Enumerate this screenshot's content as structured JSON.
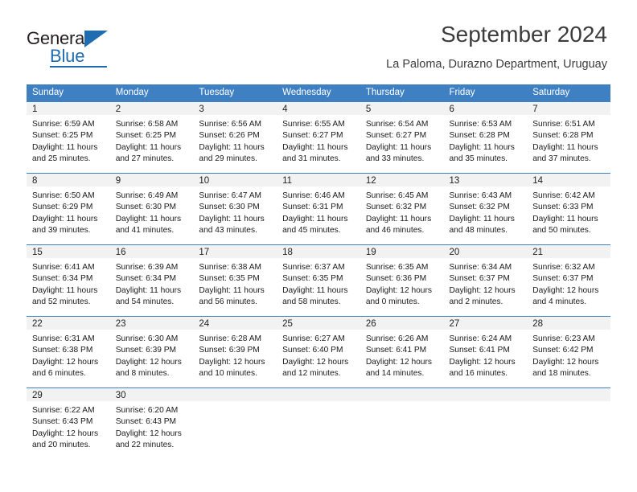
{
  "brand": {
    "name_part1": "General",
    "name_part2": "Blue",
    "triangle_icon": "blue-triangle-icon",
    "accent_color": "#1f6cb0"
  },
  "header": {
    "title": "September 2024",
    "subtitle": "La Paloma, Durazno Department, Uruguay"
  },
  "calendar": {
    "header_color": "#3f80c2",
    "weekdays": [
      "Sunday",
      "Monday",
      "Tuesday",
      "Wednesday",
      "Thursday",
      "Friday",
      "Saturday"
    ],
    "weeks": [
      [
        {
          "day": "1",
          "sunrise": "Sunrise: 6:59 AM",
          "sunset": "Sunset: 6:25 PM",
          "daylight1": "Daylight: 11 hours",
          "daylight2": "and 25 minutes."
        },
        {
          "day": "2",
          "sunrise": "Sunrise: 6:58 AM",
          "sunset": "Sunset: 6:25 PM",
          "daylight1": "Daylight: 11 hours",
          "daylight2": "and 27 minutes."
        },
        {
          "day": "3",
          "sunrise": "Sunrise: 6:56 AM",
          "sunset": "Sunset: 6:26 PM",
          "daylight1": "Daylight: 11 hours",
          "daylight2": "and 29 minutes."
        },
        {
          "day": "4",
          "sunrise": "Sunrise: 6:55 AM",
          "sunset": "Sunset: 6:27 PM",
          "daylight1": "Daylight: 11 hours",
          "daylight2": "and 31 minutes."
        },
        {
          "day": "5",
          "sunrise": "Sunrise: 6:54 AM",
          "sunset": "Sunset: 6:27 PM",
          "daylight1": "Daylight: 11 hours",
          "daylight2": "and 33 minutes."
        },
        {
          "day": "6",
          "sunrise": "Sunrise: 6:53 AM",
          "sunset": "Sunset: 6:28 PM",
          "daylight1": "Daylight: 11 hours",
          "daylight2": "and 35 minutes."
        },
        {
          "day": "7",
          "sunrise": "Sunrise: 6:51 AM",
          "sunset": "Sunset: 6:28 PM",
          "daylight1": "Daylight: 11 hours",
          "daylight2": "and 37 minutes."
        }
      ],
      [
        {
          "day": "8",
          "sunrise": "Sunrise: 6:50 AM",
          "sunset": "Sunset: 6:29 PM",
          "daylight1": "Daylight: 11 hours",
          "daylight2": "and 39 minutes."
        },
        {
          "day": "9",
          "sunrise": "Sunrise: 6:49 AM",
          "sunset": "Sunset: 6:30 PM",
          "daylight1": "Daylight: 11 hours",
          "daylight2": "and 41 minutes."
        },
        {
          "day": "10",
          "sunrise": "Sunrise: 6:47 AM",
          "sunset": "Sunset: 6:30 PM",
          "daylight1": "Daylight: 11 hours",
          "daylight2": "and 43 minutes."
        },
        {
          "day": "11",
          "sunrise": "Sunrise: 6:46 AM",
          "sunset": "Sunset: 6:31 PM",
          "daylight1": "Daylight: 11 hours",
          "daylight2": "and 45 minutes."
        },
        {
          "day": "12",
          "sunrise": "Sunrise: 6:45 AM",
          "sunset": "Sunset: 6:32 PM",
          "daylight1": "Daylight: 11 hours",
          "daylight2": "and 46 minutes."
        },
        {
          "day": "13",
          "sunrise": "Sunrise: 6:43 AM",
          "sunset": "Sunset: 6:32 PM",
          "daylight1": "Daylight: 11 hours",
          "daylight2": "and 48 minutes."
        },
        {
          "day": "14",
          "sunrise": "Sunrise: 6:42 AM",
          "sunset": "Sunset: 6:33 PM",
          "daylight1": "Daylight: 11 hours",
          "daylight2": "and 50 minutes."
        }
      ],
      [
        {
          "day": "15",
          "sunrise": "Sunrise: 6:41 AM",
          "sunset": "Sunset: 6:34 PM",
          "daylight1": "Daylight: 11 hours",
          "daylight2": "and 52 minutes."
        },
        {
          "day": "16",
          "sunrise": "Sunrise: 6:39 AM",
          "sunset": "Sunset: 6:34 PM",
          "daylight1": "Daylight: 11 hours",
          "daylight2": "and 54 minutes."
        },
        {
          "day": "17",
          "sunrise": "Sunrise: 6:38 AM",
          "sunset": "Sunset: 6:35 PM",
          "daylight1": "Daylight: 11 hours",
          "daylight2": "and 56 minutes."
        },
        {
          "day": "18",
          "sunrise": "Sunrise: 6:37 AM",
          "sunset": "Sunset: 6:35 PM",
          "daylight1": "Daylight: 11 hours",
          "daylight2": "and 58 minutes."
        },
        {
          "day": "19",
          "sunrise": "Sunrise: 6:35 AM",
          "sunset": "Sunset: 6:36 PM",
          "daylight1": "Daylight: 12 hours",
          "daylight2": "and 0 minutes."
        },
        {
          "day": "20",
          "sunrise": "Sunrise: 6:34 AM",
          "sunset": "Sunset: 6:37 PM",
          "daylight1": "Daylight: 12 hours",
          "daylight2": "and 2 minutes."
        },
        {
          "day": "21",
          "sunrise": "Sunrise: 6:32 AM",
          "sunset": "Sunset: 6:37 PM",
          "daylight1": "Daylight: 12 hours",
          "daylight2": "and 4 minutes."
        }
      ],
      [
        {
          "day": "22",
          "sunrise": "Sunrise: 6:31 AM",
          "sunset": "Sunset: 6:38 PM",
          "daylight1": "Daylight: 12 hours",
          "daylight2": "and 6 minutes."
        },
        {
          "day": "23",
          "sunrise": "Sunrise: 6:30 AM",
          "sunset": "Sunset: 6:39 PM",
          "daylight1": "Daylight: 12 hours",
          "daylight2": "and 8 minutes."
        },
        {
          "day": "24",
          "sunrise": "Sunrise: 6:28 AM",
          "sunset": "Sunset: 6:39 PM",
          "daylight1": "Daylight: 12 hours",
          "daylight2": "and 10 minutes."
        },
        {
          "day": "25",
          "sunrise": "Sunrise: 6:27 AM",
          "sunset": "Sunset: 6:40 PM",
          "daylight1": "Daylight: 12 hours",
          "daylight2": "and 12 minutes."
        },
        {
          "day": "26",
          "sunrise": "Sunrise: 6:26 AM",
          "sunset": "Sunset: 6:41 PM",
          "daylight1": "Daylight: 12 hours",
          "daylight2": "and 14 minutes."
        },
        {
          "day": "27",
          "sunrise": "Sunrise: 6:24 AM",
          "sunset": "Sunset: 6:41 PM",
          "daylight1": "Daylight: 12 hours",
          "daylight2": "and 16 minutes."
        },
        {
          "day": "28",
          "sunrise": "Sunrise: 6:23 AM",
          "sunset": "Sunset: 6:42 PM",
          "daylight1": "Daylight: 12 hours",
          "daylight2": "and 18 minutes."
        }
      ],
      [
        {
          "day": "29",
          "sunrise": "Sunrise: 6:22 AM",
          "sunset": "Sunset: 6:43 PM",
          "daylight1": "Daylight: 12 hours",
          "daylight2": "and 20 minutes."
        },
        {
          "day": "30",
          "sunrise": "Sunrise: 6:20 AM",
          "sunset": "Sunset: 6:43 PM",
          "daylight1": "Daylight: 12 hours",
          "daylight2": "and 22 minutes."
        },
        {
          "day": "",
          "sunrise": "",
          "sunset": "",
          "daylight1": "",
          "daylight2": ""
        },
        {
          "day": "",
          "sunrise": "",
          "sunset": "",
          "daylight1": "",
          "daylight2": ""
        },
        {
          "day": "",
          "sunrise": "",
          "sunset": "",
          "daylight1": "",
          "daylight2": ""
        },
        {
          "day": "",
          "sunrise": "",
          "sunset": "",
          "daylight1": "",
          "daylight2": ""
        },
        {
          "day": "",
          "sunrise": "",
          "sunset": "",
          "daylight1": "",
          "daylight2": ""
        }
      ]
    ]
  }
}
